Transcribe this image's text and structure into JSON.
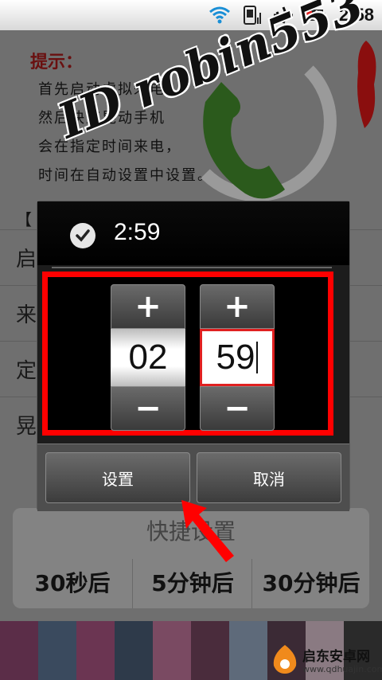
{
  "status_bar": {
    "time": "2:58",
    "icons": [
      "wifi-icon",
      "signal-icon",
      "airplane-icon",
      "battery-charging-icon"
    ]
  },
  "background_app": {
    "hint": {
      "title": "提示：",
      "lines": [
        "首先启动虚拟来电，",
        "然后快速晃动手机",
        "会在指定时间来电，",
        "时间在自动设置中设置。"
      ],
      "watermark": "ID robin553"
    },
    "section_label": "【",
    "rows": [
      "启",
      "来电人物",
      "定时来电",
      "晃动来电"
    ],
    "quick": {
      "title": "快捷设置",
      "buttons": [
        "30秒后",
        "5分钟后",
        "30分钟后"
      ]
    }
  },
  "dialog": {
    "title": "2:59",
    "hour": {
      "value": "02",
      "inc": "+",
      "dec": "−"
    },
    "minute": {
      "value": "59",
      "inc": "+",
      "dec": "−"
    },
    "set_label": "设置",
    "cancel_label": "取消"
  },
  "badge": {
    "name": "启东安卓网",
    "url": "www.qdhuajin.com"
  },
  "colors": {
    "highlight": "#ff0000",
    "dialog_bg": "#1c1c1c",
    "overlay": "#6f6f6f"
  }
}
